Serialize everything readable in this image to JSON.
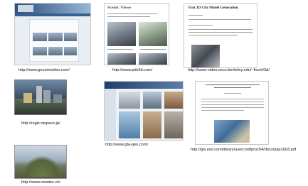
{
  "captions": {
    "geosimcities": "http://www.geosimcities.com/",
    "pdx3d": "http://www.pdx3d.com/",
    "eecs": "http://www-video.eecs.berkeley.edu/~frueh/3d/",
    "rsgis": "http://rsgis.ntspace.jp/",
    "gtageo": "http://www.gta-geo.com/",
    "esri": "http://gis.esri.com/library/userconf/proc04/docs/pap1693.pdf",
    "viewtec": "http://www.viewtec.ch/"
  },
  "thumbnails": {
    "pdx3d_title": "Scenic Views",
    "eecs_title": "Fast 3D City Model Generation"
  }
}
